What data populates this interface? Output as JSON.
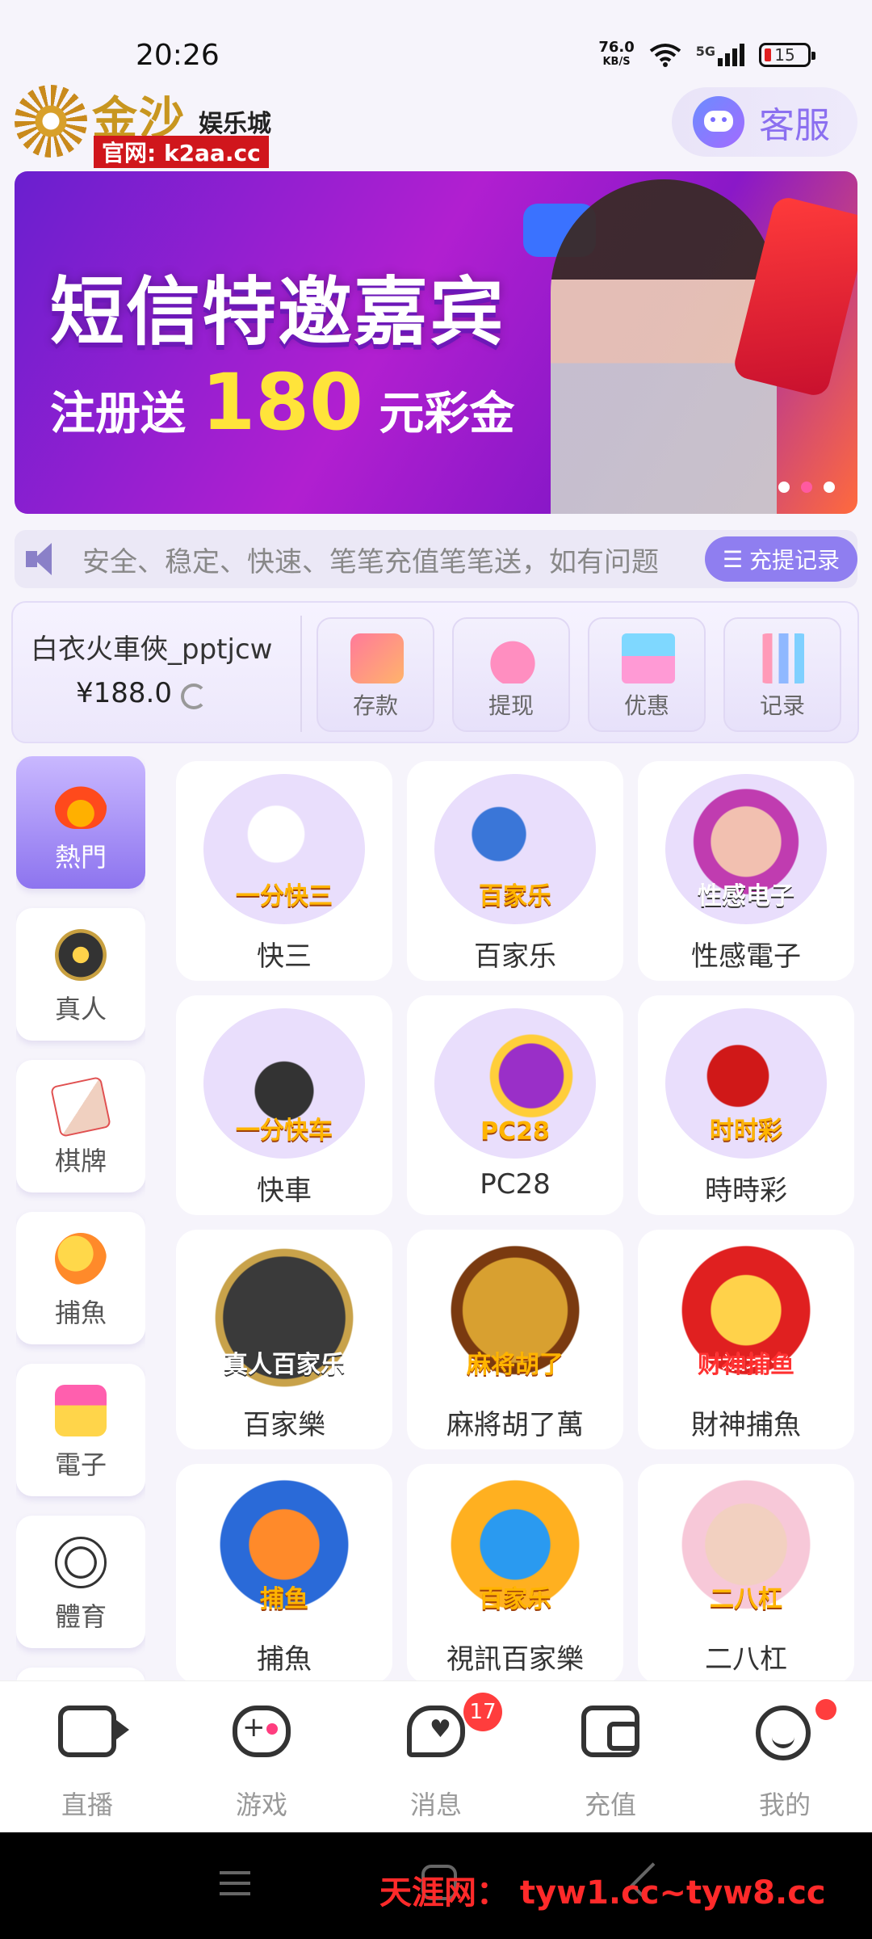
{
  "status_bar": {
    "time": "20:26",
    "net_speed_value": "76.0",
    "net_speed_unit": "KB/S",
    "network": "5G",
    "battery": "15"
  },
  "header": {
    "logo_main": "金沙",
    "logo_sub": "娱乐城",
    "logo_url": "官网: k2aa.cc",
    "service_label": "客服"
  },
  "banner": {
    "title": "短信特邀嘉宾",
    "subtitle_prefix": "注册送",
    "amount": "180",
    "subtitle_suffix": "元彩金",
    "active_dot": 2,
    "dot_count": 3
  },
  "notice": {
    "text": "安全、稳定、快速、笔笔充值笔笔送，如有问题",
    "record_button": "充提记录"
  },
  "user": {
    "name": "白衣火車俠_pptjcw",
    "balance": "¥188.0"
  },
  "actions": [
    {
      "label": "存款",
      "icon": "card-icon"
    },
    {
      "label": "提现",
      "icon": "money-bag-icon"
    },
    {
      "label": "优惠",
      "icon": "gift-icon"
    },
    {
      "label": "记录",
      "icon": "bar-chart-icon"
    }
  ],
  "categories": [
    {
      "label": "熱門",
      "icon": "fire-icon",
      "active": true
    },
    {
      "label": "真人",
      "icon": "poker-chip-icon",
      "active": false
    },
    {
      "label": "棋牌",
      "icon": "playing-card-icon",
      "active": false
    },
    {
      "label": "捕魚",
      "icon": "fish-icon",
      "active": false
    },
    {
      "label": "電子",
      "icon": "slot-machine-icon",
      "active": false
    },
    {
      "label": "體育",
      "icon": "soccer-ball-icon",
      "active": false
    }
  ],
  "games": [
    {
      "label": "快三",
      "art_text": "一分快三"
    },
    {
      "label": "百家乐",
      "art_text": "百家乐"
    },
    {
      "label": "性感電子",
      "art_text": "性感电子"
    },
    {
      "label": "快車",
      "art_text": "一分快车"
    },
    {
      "label": "PC28",
      "art_text": "PC28"
    },
    {
      "label": "時時彩",
      "art_text": "时时彩"
    },
    {
      "label": "百家樂",
      "art_text": "真人百家乐"
    },
    {
      "label": "麻將胡了萬",
      "art_text": "麻将胡了"
    },
    {
      "label": "財神捕魚",
      "art_text": "财神捕鱼"
    },
    {
      "label": "捕魚",
      "art_text": "捕鱼"
    },
    {
      "label": "視訊百家樂",
      "art_text": "百家乐"
    },
    {
      "label": "二八杠",
      "art_text": "二八杠"
    }
  ],
  "bottom_nav": [
    {
      "label": "直播",
      "icon": "video-camera-icon"
    },
    {
      "label": "游戏",
      "icon": "gamepad-icon"
    },
    {
      "label": "消息",
      "icon": "chat-bubble-icon",
      "badge": "17"
    },
    {
      "label": "充值",
      "icon": "wallet-icon"
    },
    {
      "label": "我的",
      "icon": "smiley-icon",
      "dot": true
    }
  ],
  "watermark": "天涯网： tyw1.cc~tyw8.cc"
}
